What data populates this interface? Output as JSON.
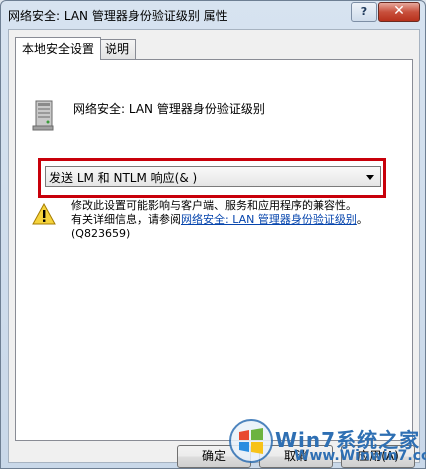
{
  "window": {
    "title": "网络安全: LAN 管理器身份验证级别 属性",
    "help_label": "?",
    "close_label": "✕"
  },
  "tabs": [
    {
      "label": "本地安全设置",
      "active": true
    },
    {
      "label": "说明",
      "active": false
    }
  ],
  "policy": {
    "name": "网络安全: LAN 管理器身份验证级别",
    "icon": "server-icon"
  },
  "dropdown": {
    "selected": "发送 LM 和 NTLM 响应(&  )"
  },
  "warning": {
    "icon": "warning-icon",
    "line1": "修改此设置可能影响与客户端、服务和应用程序的兼容性。",
    "line2_prefix": "有关详细信息，请参阅",
    "link_text": "网络安全: LAN 管理器身份验证级别",
    "line2_suffix": "。",
    "line3": "(Q823659)"
  },
  "buttons": {
    "ok": "确定",
    "cancel": "取消",
    "apply": "应用(A)"
  },
  "watermark": {
    "brand": "Win7系统之家",
    "site": "Www.Winwin7.com"
  },
  "colors": {
    "highlight_border": "#c8000a",
    "link": "#0645ad"
  }
}
